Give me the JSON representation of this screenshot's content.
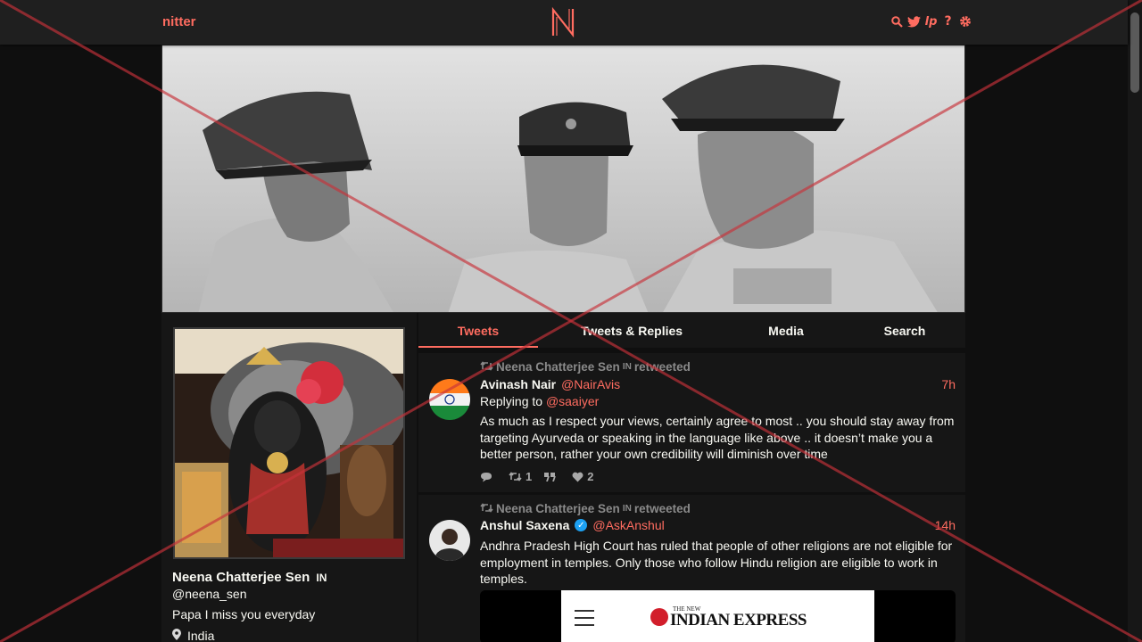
{
  "nav": {
    "brand": "nitter",
    "icons": [
      "search-icon",
      "twitter-icon",
      "lp-icon",
      "help-icon",
      "settings-icon"
    ],
    "accent_color": "#ff6c60"
  },
  "profile": {
    "fullname": "Neena Chatterjee Sen",
    "flag_badge": "IN",
    "username": "@neena_sen",
    "bio": "Papa I miss you everyday",
    "location": "India"
  },
  "tabs": [
    {
      "label": "Tweets",
      "active": true
    },
    {
      "label": "Tweets & Replies",
      "active": false
    },
    {
      "label": "Media",
      "active": false
    },
    {
      "label": "Search",
      "active": false
    }
  ],
  "tweets": [
    {
      "retweet_by": "Neena Chatterjee Sen",
      "retweet_badge": "IN",
      "retweet_suffix": "retweeted",
      "fullname": "Avinash Nair",
      "username": "@NairAvis",
      "date": "7h",
      "replying_label": "Replying to",
      "replying_to": "@saaiyer",
      "content": "As much as I respect your views, certainly agree to most .. you should stay away from targeting Ayurveda or speaking in the language like above .. it doesn’t make you a better person, rather your own credibility will diminish over time",
      "stats": {
        "comments": "",
        "retweets": "1",
        "quotes": "",
        "likes": "2"
      }
    },
    {
      "retweet_by": "Neena Chatterjee Sen",
      "retweet_badge": "IN",
      "retweet_suffix": "retweeted",
      "fullname": "Anshul Saxena",
      "verified": true,
      "username": "@AskAnshul",
      "date": "14h",
      "content": "Andhra Pradesh High Court has ruled that people of other religions are not eligible for employment in temples. Only those who follow Hindu religion are eligible to work in temples.",
      "media": {
        "masthead_small": "THE NEW",
        "masthead": "INDIAN EXPRESS"
      }
    }
  ]
}
